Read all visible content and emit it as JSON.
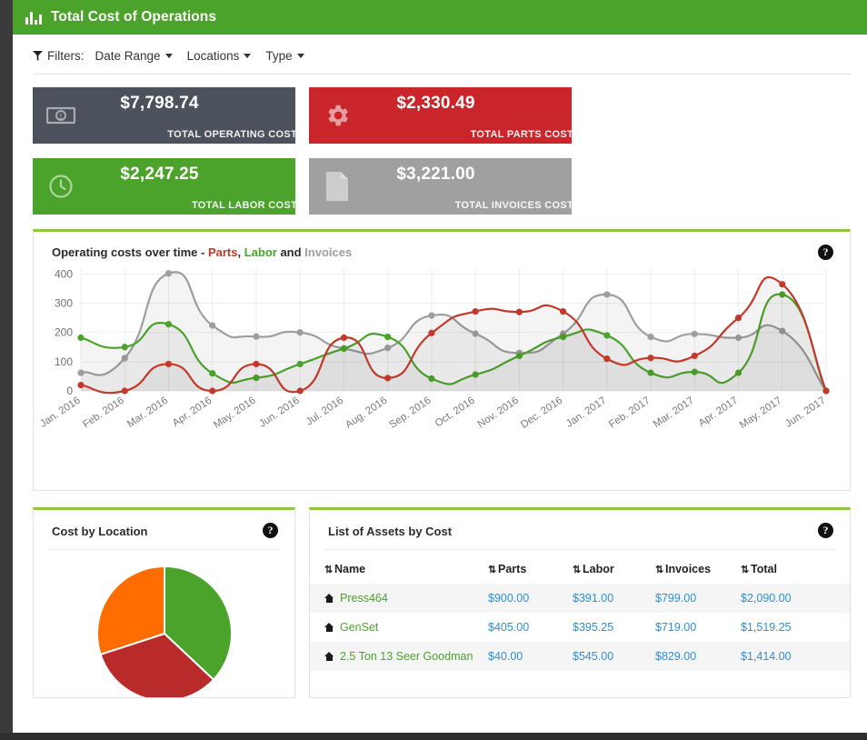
{
  "header": {
    "title": "Total Cost of Operations",
    "icon": "bar-chart-icon",
    "bg_color": "#4ca32b"
  },
  "filters": {
    "icon": "filter-funnel-icon",
    "label": "Filters:",
    "items": [
      {
        "label": "Date Range"
      },
      {
        "label": "Locations"
      },
      {
        "label": "Type"
      }
    ]
  },
  "kpis": [
    {
      "value": "$7,798.74",
      "label": "TOTAL OPERATING COST",
      "color": "#4c525c",
      "icon": "money-bill-icon"
    },
    {
      "value": "$2,330.49",
      "label": "TOTAL PARTS COST",
      "color": "#c9252b",
      "icon": "gear-icon"
    },
    {
      "value": "$2,247.25",
      "label": "TOTAL LABOR COST",
      "color": "#4ca32b",
      "icon": "clock-icon"
    },
    {
      "value": "$3,221.00",
      "label": "TOTAL INVOICES COST",
      "color": "#a0a0a0",
      "icon": "document-icon"
    }
  ],
  "chart_panel": {
    "title_prefix": "Operating costs over time - ",
    "series_parts": "Parts",
    "series_sep1": ", ",
    "series_labor": "Labor",
    "series_sep2": " and ",
    "series_invoices": "Invoices",
    "help_glyph": "?"
  },
  "chart_data": {
    "type": "line",
    "title": "Operating costs over time - Parts, Labor and Invoices",
    "xlabel": "",
    "ylabel": "",
    "ylim": [
      0,
      420
    ],
    "yticks": [
      0,
      100,
      200,
      300,
      400
    ],
    "grid": true,
    "legend": "in-title",
    "categories": [
      "Jan. 2016",
      "Feb. 2016",
      "Mar. 2016",
      "Apr. 2016",
      "May. 2016",
      "Jun. 2016",
      "Jul. 2016",
      "Aug. 2016",
      "Sep. 2016",
      "Oct. 2016",
      "Nov. 2016",
      "Dec. 2016",
      "Jan. 2017",
      "Feb. 2017",
      "Mar. 2017",
      "Apr. 2017",
      "May. 2017",
      "Jun. 2017"
    ],
    "series": [
      {
        "name": "Parts",
        "color": "#c0392b",
        "values": [
          20,
          0,
          92,
          0,
          92,
          0,
          182,
          44,
          198,
          272,
          270,
          272,
          110,
          113,
          120,
          250,
          365,
          0
        ]
      },
      {
        "name": "Labor",
        "color": "#4ca32b",
        "values": [
          182,
          150,
          228,
          60,
          45,
          92,
          145,
          185,
          42,
          56,
          120,
          185,
          190,
          62,
          65,
          62,
          330,
          0
        ]
      },
      {
        "name": "Invoices",
        "color": "#9e9e9e",
        "values": [
          62,
          112,
          402,
          224,
          186,
          200,
          145,
          147,
          258,
          196,
          130,
          196,
          330,
          185,
          195,
          182,
          205,
          0
        ]
      }
    ]
  },
  "pie_panel": {
    "title": "Cost by Location",
    "help_glyph": "?"
  },
  "pie_chart_data": {
    "type": "pie",
    "title": "Cost by Location",
    "slices": [
      {
        "label": "",
        "value": 37,
        "color": "#4ca32b"
      },
      {
        "label": "",
        "value": 33,
        "color": "#b92a2a"
      },
      {
        "label": "",
        "value": 30,
        "color": "#ff6d00"
      }
    ]
  },
  "assets_panel": {
    "title": "List of Assets by Cost",
    "help_glyph": "?",
    "sort_glyph": "⇅",
    "columns": [
      "Name",
      "Parts",
      "Labor",
      "Invoices",
      "Total"
    ],
    "rows": [
      {
        "name": "Press464",
        "parts": "$900.00",
        "labor": "$391.00",
        "invoices": "$799.00",
        "total": "$2,090.00"
      },
      {
        "name": "GenSet",
        "parts": "$405.00",
        "labor": "$395.25",
        "invoices": "$719.00",
        "total": "$1,519.25"
      },
      {
        "name": "2.5 Ton 13 Seer Goodman",
        "parts": "$40.00",
        "labor": "$545.00",
        "invoices": "$829.00",
        "total": "$1,414.00"
      }
    ]
  }
}
